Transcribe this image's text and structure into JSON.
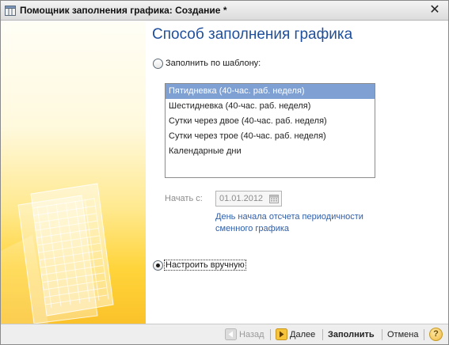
{
  "window": {
    "title": "Помощник заполнения графика: Создание *",
    "close_glyph": "✕"
  },
  "main": {
    "heading": "Способ заполнения графика",
    "template_option": {
      "label": "Заполнить по шаблону:",
      "selected": false
    },
    "templates": [
      {
        "label": "Пятидневка (40-час. раб. неделя)",
        "selected": true
      },
      {
        "label": "Шестидневка (40-час. раб. неделя)",
        "selected": false
      },
      {
        "label": "Сутки через двое (40-час. раб. неделя)",
        "selected": false
      },
      {
        "label": "Сутки через трое (40-час. раб. неделя)",
        "selected": false
      },
      {
        "label": "Календарные дни",
        "selected": false
      }
    ],
    "start_label": "Начать с:",
    "start_date": "01.01.2012",
    "hint": "День начала отсчета периодичности сменного графика",
    "manual_option": {
      "label": "Настроить вручную",
      "selected": true
    }
  },
  "footer": {
    "back_label": "Назад",
    "next_label": "Далее",
    "fill_label": "Заполнить",
    "cancel_label": "Отмена",
    "help_label": "?"
  },
  "colors": {
    "heading": "#1f4f9c",
    "link": "#2f5ea8",
    "selection": "#7fa0d2",
    "side_panel": "#ffd43a"
  },
  "icons": {
    "title": "table-icon",
    "calendar": "calendar-icon",
    "back": "arrow-left-icon",
    "next": "arrow-right-icon",
    "help": "help-icon"
  }
}
